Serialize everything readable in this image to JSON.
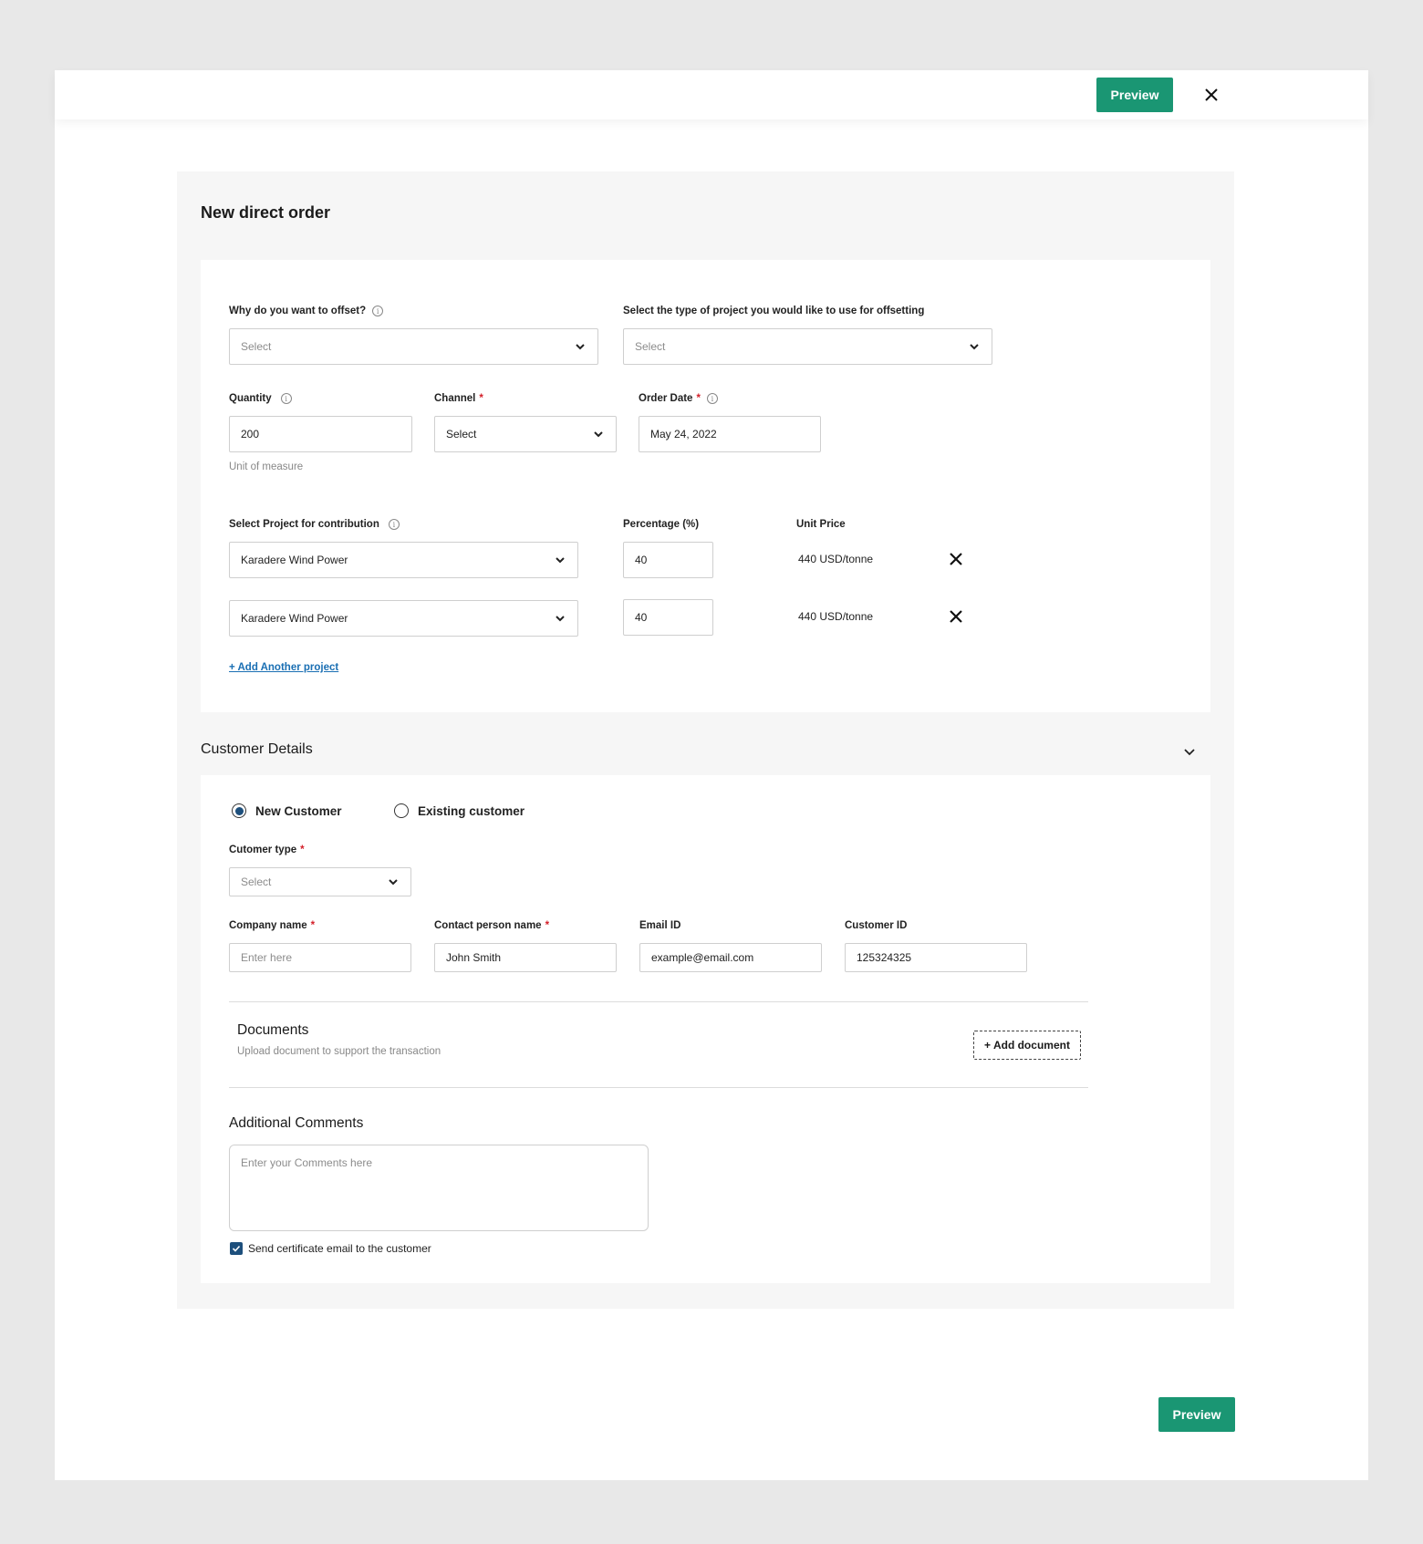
{
  "header": {
    "preview_label": "Preview"
  },
  "order": {
    "title": "New direct order",
    "offset_reason": {
      "label": "Why do you want to offset?",
      "placeholder": "Select"
    },
    "project_type": {
      "label": "Select the type of project you would like to use for offsetting",
      "placeholder": "Select"
    },
    "quantity": {
      "label": "Quantity",
      "value": "200",
      "helper": "Unit of measure"
    },
    "channel": {
      "label": "Channel",
      "value": "Select"
    },
    "order_date": {
      "label": "Order Date",
      "value": "May 24, 2022"
    },
    "contribution": {
      "project_label": "Select Project for contribution",
      "percentage_label": "Percentage (%)",
      "unit_price_label": "Unit Price",
      "rows": [
        {
          "project": "Karadere Wind Power",
          "percentage": "40",
          "unit_price": "440 USD/tonne"
        },
        {
          "project": "Karadere Wind Power",
          "percentage": "40",
          "unit_price": "440 USD/tonne"
        }
      ],
      "add_link": "+ Add Another project"
    }
  },
  "customer": {
    "title": "Customer Details",
    "radio_new": "New Customer",
    "radio_existing": "Existing customer",
    "selected": "new",
    "customer_type": {
      "label": "Cutomer type",
      "placeholder": "Select"
    },
    "company_name": {
      "label": "Company name",
      "placeholder": "Enter here"
    },
    "contact_person": {
      "label": "Contact person name",
      "value": "John Smith"
    },
    "email": {
      "label": "Email ID",
      "value": "example@email.com"
    },
    "customer_id": {
      "label": "Customer ID",
      "value": "125324325"
    },
    "documents": {
      "title": "Documents",
      "subtitle": "Upload document to support the transaction",
      "add_label": "+ Add document"
    },
    "comments": {
      "title": "Additional Comments",
      "placeholder": "Enter your Comments here"
    },
    "send_certificate": {
      "label": "Send certificate email to the customer",
      "checked": true
    }
  },
  "footer": {
    "preview_label": "Preview"
  },
  "colors": {
    "accent": "#1a9673",
    "link": "#1a6fb3",
    "required": "#d4202a",
    "radio": "#1d4f7c"
  }
}
